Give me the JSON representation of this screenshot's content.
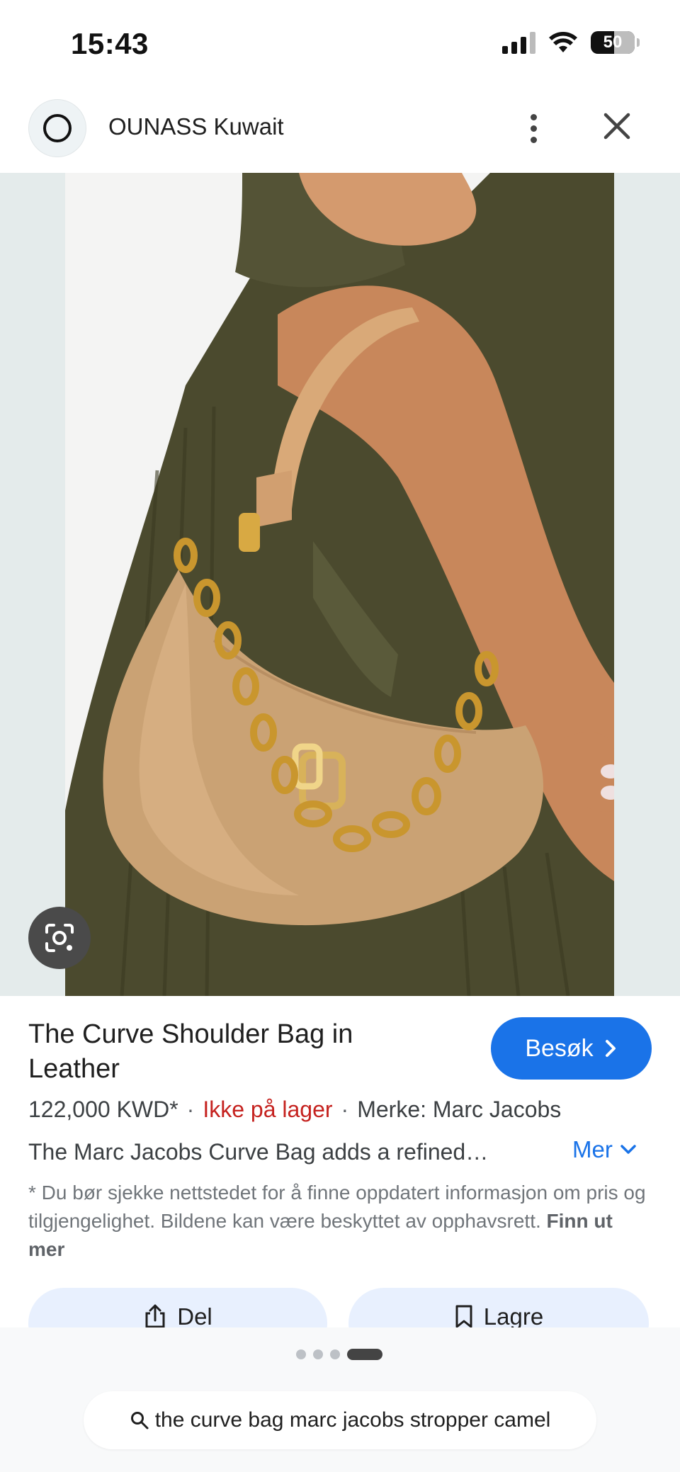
{
  "status_bar": {
    "time": "15:43",
    "battery": "50",
    "icons": [
      "cellular-signal-icon",
      "wifi-icon",
      "battery-icon"
    ]
  },
  "header": {
    "site_name": "OUNASS Kuwait",
    "logo_icon": "ounass-logo-icon",
    "more_icon": "more-vertical-icon",
    "close_icon": "close-icon"
  },
  "image": {
    "lens_icon": "google-lens-icon"
  },
  "product": {
    "title": "The Curve Shoulder Bag in Leather",
    "visit_label": "Besøk",
    "price": "122,000 KWD*",
    "separator": "·",
    "stock_status": "Ikke på lager",
    "brand": "Merke: Marc Jacobs",
    "description": "The Marc Jacobs Curve Bag adds a refined…",
    "more_label": "Mer",
    "disclaimer": "* Du bør sjekke nettstedet for å finne oppdatert informasjon om pris og tilgjengelighet. Bildene kan være beskyttet av opphavsrett.",
    "learn_more": "Finn ut mer"
  },
  "actions": {
    "share_label": "Del",
    "save_label": "Lagre"
  },
  "pager": {
    "count": 4,
    "active_index": 3
  },
  "search": {
    "query": "the curve bag marc jacobs stropper camel",
    "icon": "search-icon"
  },
  "colors": {
    "accent_blue": "#1a73e8",
    "stock_red": "#c5221f",
    "action_bg": "#e8f0fe"
  }
}
